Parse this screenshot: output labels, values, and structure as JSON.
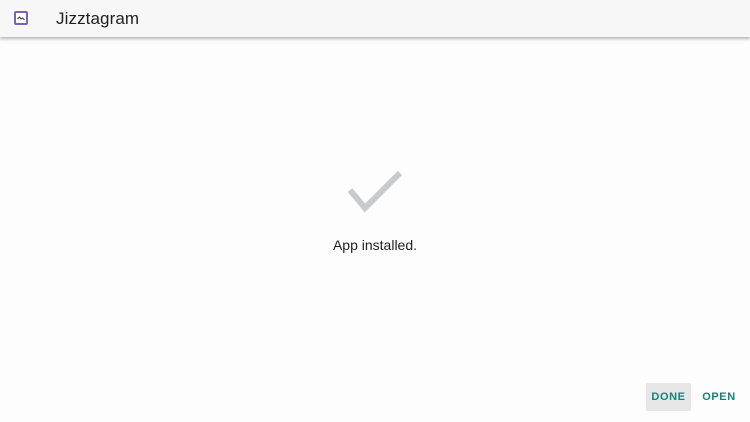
{
  "header": {
    "app_name": "Jizztagram",
    "icon": "app-icon"
  },
  "main": {
    "status_icon": "checkmark-icon",
    "status_text": "App installed."
  },
  "actions": {
    "done_label": "DONE",
    "open_label": "OPEN"
  },
  "colors": {
    "accent": "#138577",
    "checkmark": "#c8cbcd",
    "icon_border": "#7b62b7"
  }
}
